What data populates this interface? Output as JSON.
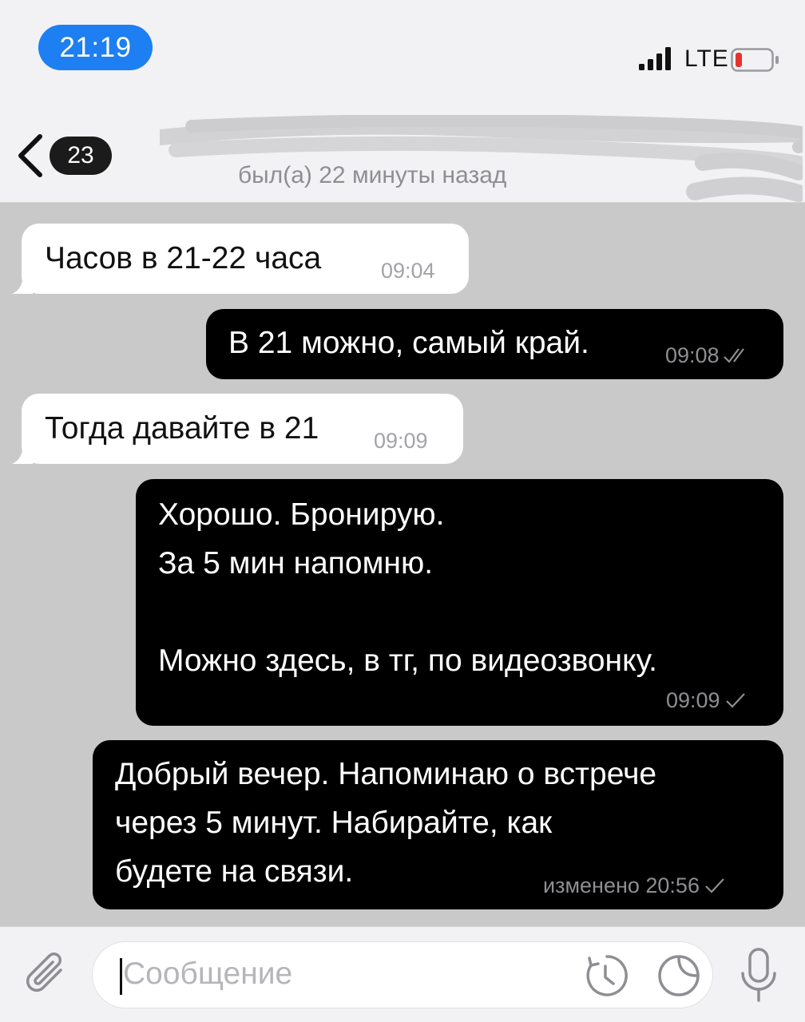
{
  "status_bar": {
    "time": "21:19",
    "network": "LTE",
    "battery_color": "#e8312e"
  },
  "header": {
    "unread_count": "23",
    "contact_name": "",
    "last_seen": "был(а) 22 минуты назад"
  },
  "messages": [
    {
      "direction": "in",
      "text": "Часов в 21-22 часа",
      "time": "09:04",
      "status": ""
    },
    {
      "direction": "out",
      "text": "В 21 можно, самый край.",
      "time": "09:08",
      "status": "read"
    },
    {
      "direction": "in",
      "text": "Тогда давайте в 21",
      "time": "09:09",
      "status": ""
    },
    {
      "direction": "out",
      "text": "Хорошо. Бронирую.\nЗа 5 мин напомню.\n\nМожно здесь, в тг, по видеозвонку.",
      "time": "09:09",
      "status": "sent"
    },
    {
      "direction": "out",
      "text": "Добрый вечер. Напоминаю о встрече\nчерез 5 минут. Набирайте, как\nбудете на связи.",
      "time": "изменено 20:56",
      "status": "sent"
    }
  ],
  "input": {
    "placeholder": "Сообщение"
  },
  "icons": {
    "back": "chevron-left-icon",
    "attach": "paperclip-icon",
    "schedule": "clock-icon",
    "sticker": "sticker-icon",
    "mic": "microphone-icon"
  },
  "colors": {
    "accent": "#1d7ff2",
    "chat_background": "#c9c9c9",
    "incoming_bubble": "#ffffff",
    "outgoing_bubble": "#000000"
  }
}
